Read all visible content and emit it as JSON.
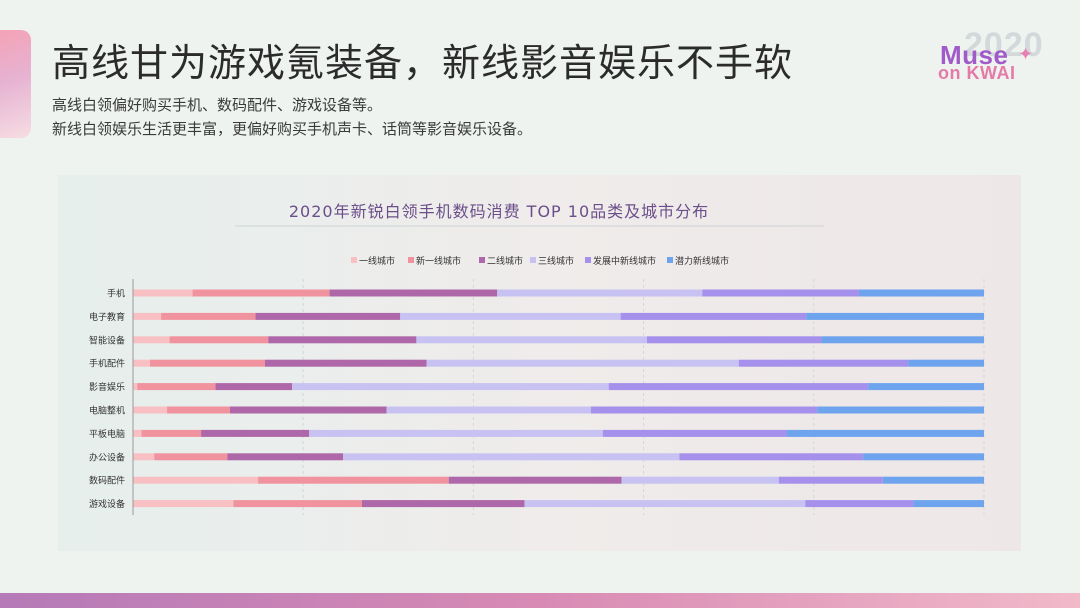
{
  "slide": {
    "headline": "高线甘为游戏氪装备，新线影音娱乐不手软",
    "sublines": [
      "高线白领偏好购买手机、数码配件、游戏设备等。",
      "新线白领娱乐生活更丰富，更偏好购买手机声卡、话筒等影音娱乐设备。"
    ]
  },
  "logo": {
    "year": "2020",
    "word1": "Muse",
    "word2": "on KWAI"
  },
  "chart_data": {
    "type": "bar",
    "orientation": "horizontal",
    "stacked": "100%",
    "title": "2020年新锐白领手机数码消费 TOP 10品类及城市分布",
    "xlabel": "",
    "ylabel": "",
    "xlim": [
      0,
      100
    ],
    "grid": true,
    "legend_position": "top",
    "categories": [
      "手机",
      "电子教育",
      "智能设备",
      "手机配件",
      "影音娱乐",
      "电脑整机",
      "平板电脑",
      "办公设备",
      "数码配件",
      "游戏设备"
    ],
    "series": [
      {
        "name": "一线城市",
        "color": "#f8c0c3",
        "values": [
          7,
          3.3,
          4.3,
          2,
          0.5,
          4,
          1,
          2.5,
          14.7,
          11.8
        ]
      },
      {
        "name": "新一线城市",
        "color": "#f0939f",
        "values": [
          16.1,
          11.1,
          11.6,
          13.5,
          9.2,
          7.4,
          7,
          8.6,
          22.4,
          15.1
        ]
      },
      {
        "name": "二线城市",
        "color": "#ae67a9",
        "values": [
          19.7,
          17,
          17.4,
          19,
          9,
          18.4,
          12.7,
          13.6,
          20.3,
          19.1
        ]
      },
      {
        "name": "三线城市",
        "color": "#c7c2f1",
        "values": [
          24.1,
          25.9,
          27.1,
          36.7,
          37.2,
          24,
          34.5,
          39.5,
          18.5,
          33
        ]
      },
      {
        "name": "发展中新线城市",
        "color": "#a590ec",
        "values": [
          18.4,
          21.8,
          20.5,
          19.9,
          30.5,
          26.6,
          21.6,
          21.6,
          12.2,
          12.7
        ]
      },
      {
        "name": "潜力新线城市",
        "color": "#6ea3ee",
        "values": [
          14.7,
          20.9,
          19.1,
          8.9,
          13.6,
          19.6,
          23.2,
          14.2,
          11.9,
          8.3
        ]
      }
    ]
  }
}
